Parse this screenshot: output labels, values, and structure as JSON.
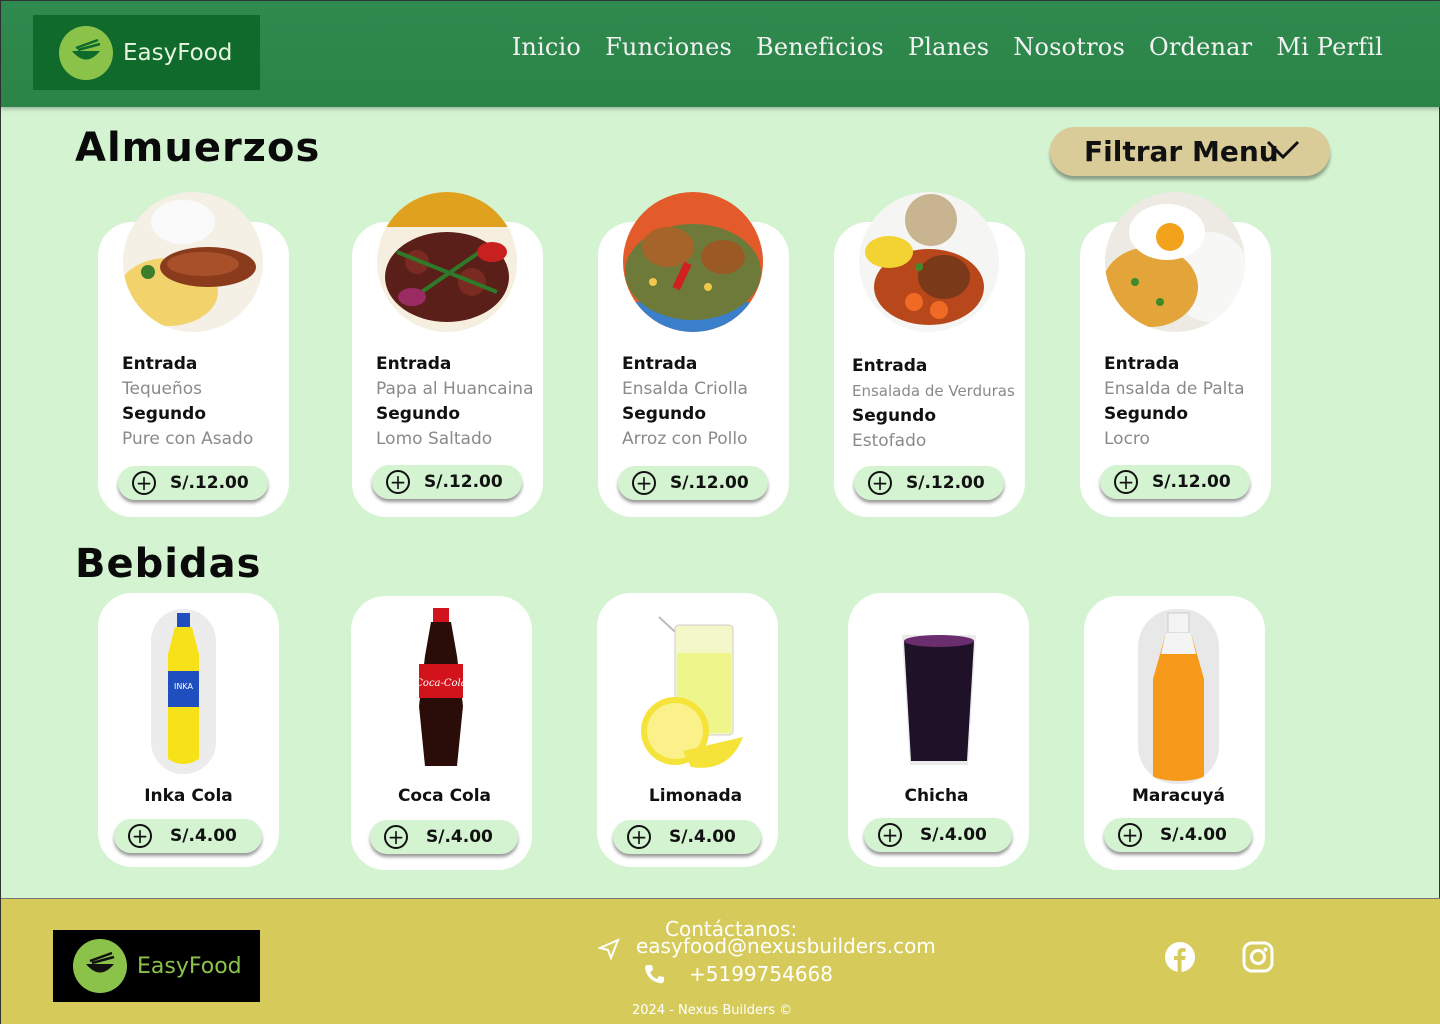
{
  "brand": {
    "name": "EasyFood"
  },
  "nav": [
    "Inicio",
    "Funciones",
    "Beneficios",
    "Planes",
    "Nosotros",
    "Ordenar",
    "Mi Perfil"
  ],
  "lunch": {
    "title": "Almuerzos",
    "filter_label": "Filtrar Menu",
    "entry_label": "Entrada",
    "main_label": "Segundo",
    "items": [
      {
        "entrada": "Tequeños",
        "segundo": "Pure con Asado",
        "price": "S/.12.00"
      },
      {
        "entrada": "Papa al Huancaina",
        "segundo": "Lomo Saltado",
        "price": "S/.12.00"
      },
      {
        "entrada": "Ensalda Criolla",
        "segundo": "Arroz con Pollo",
        "price": "S/.12.00"
      },
      {
        "entrada": "Ensalada de Verduras",
        "segundo": "Estofado",
        "price": "S/.12.00"
      },
      {
        "entrada": "Ensalda de Palta",
        "segundo": "Locro",
        "price": "S/.12.00"
      }
    ]
  },
  "drinks": {
    "title": "Bebidas",
    "items": [
      {
        "name": "Inka Cola",
        "price": "S/.4.00"
      },
      {
        "name": "Coca Cola",
        "price": "S/.4.00"
      },
      {
        "name": "Limonada",
        "price": "S/.4.00"
      },
      {
        "name": "Chicha",
        "price": "S/.4.00"
      },
      {
        "name": "Maracuyá",
        "price": "S/.4.00"
      }
    ]
  },
  "footer": {
    "contact_heading": "Contáctanos:",
    "email": "easyfood@nexusbuilders.com",
    "phone": "+5199754668",
    "copyright": "2024 - Nexus Builders ©"
  },
  "colors": {
    "header": "#2e884c",
    "background": "#d3f3d1",
    "footer": "#d6cb5a",
    "filter_button": "#d9cc98"
  }
}
